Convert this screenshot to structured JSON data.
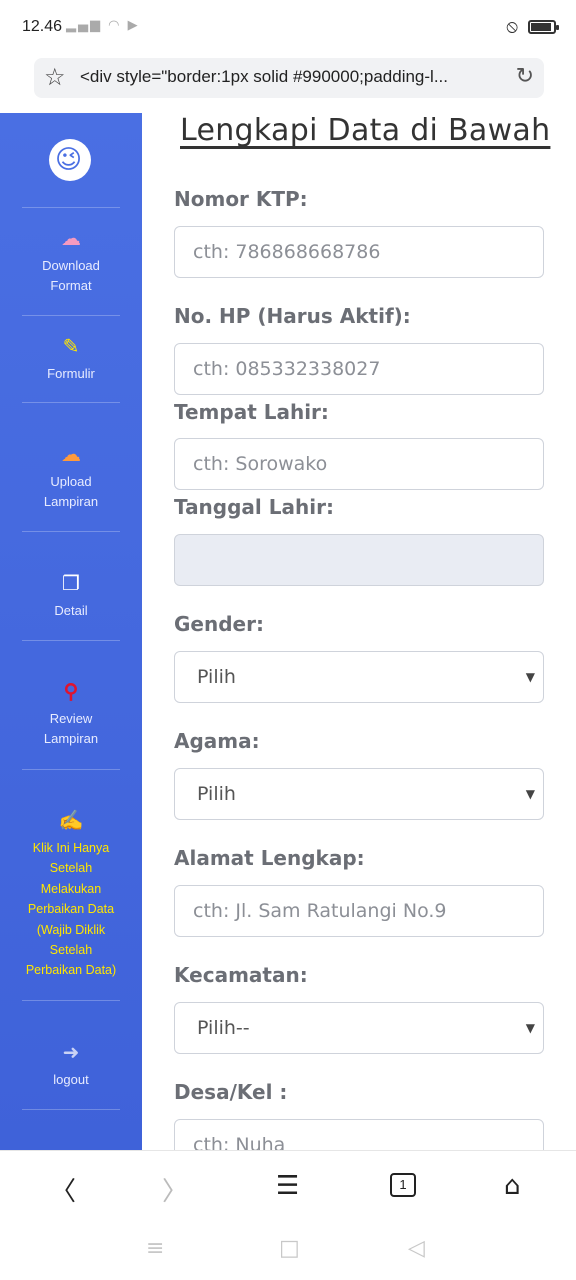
{
  "status": {
    "time": "12.46"
  },
  "browser": {
    "url": "<div style=\"border:1px solid #990000;padding-l..."
  },
  "sidebar": {
    "items": [
      {
        "icon": "cloud-download-icon",
        "glyph": "☁",
        "label_lines": [
          "Download",
          "Format"
        ],
        "color": "#f59ac0"
      },
      {
        "icon": "edit-icon",
        "glyph": "✎",
        "label_lines": [
          "Formulir"
        ],
        "color": "#ffe600"
      },
      {
        "icon": "cloud-upload-icon",
        "glyph": "☁",
        "label_lines": [
          "Upload",
          "Lampiran"
        ],
        "color": "#ff9a3c"
      },
      {
        "icon": "copy-icon",
        "glyph": "❐",
        "label_lines": [
          "Detail"
        ],
        "color": "#ffffff"
      },
      {
        "icon": "search-icon",
        "glyph": "⚲",
        "label_lines": [
          "Review",
          "Lampiran"
        ],
        "color": "#e0142f"
      },
      {
        "icon": "user-edit-icon",
        "glyph": "✍",
        "label_lines": [
          "Klik Ini Hanya",
          "Setelah",
          "Melakukan",
          "Perbaikan Data",
          "(Wajib Diklik",
          "Setelah",
          "Perbaikan Data)"
        ],
        "color": "#ffe600"
      },
      {
        "icon": "logout-icon",
        "glyph": "➜",
        "label_lines": [
          "logout"
        ],
        "color": "#c9d2f5"
      }
    ]
  },
  "form": {
    "title": "Lengkapi Data di Bawah",
    "fields": {
      "ktp": {
        "label": "Nomor KTP:",
        "placeholder": "cth: 786868668786"
      },
      "hp": {
        "label": "No. HP (Harus Aktif):",
        "placeholder": "cth: 085332338027"
      },
      "tempat": {
        "label": "Tempat Lahir:",
        "placeholder": "cth: Sorowako"
      },
      "tanggal": {
        "label": "Tanggal Lahir:",
        "value": ""
      },
      "gender": {
        "label": "Gender:",
        "selected": "Pilih"
      },
      "agama": {
        "label": "Agama:",
        "selected": "Pilih"
      },
      "alamat": {
        "label": "Alamat Lengkap:",
        "placeholder": "cth: Jl. Sam Ratulangi No.9"
      },
      "kecamatan": {
        "label": "Kecamatan:",
        "selected": "Pilih--"
      },
      "desa": {
        "label": "Desa/Kel :",
        "placeholder": "cth: Nuha"
      }
    }
  },
  "bottom_bar": {
    "tab_count": "1"
  }
}
